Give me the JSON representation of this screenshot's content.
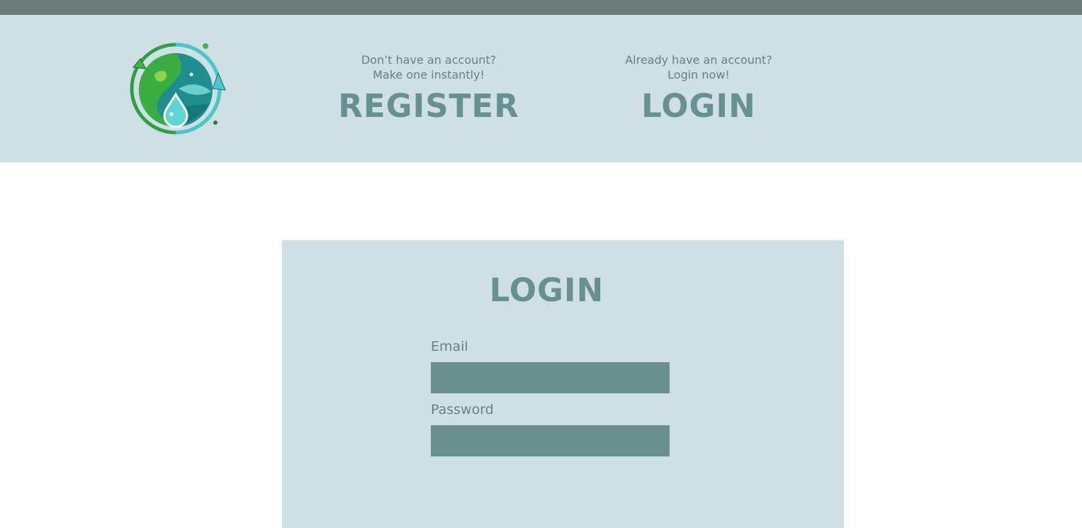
{
  "header": {
    "register": {
      "line1": "Don’t have an account?",
      "line2": "Make one instantly!",
      "label": "REGISTER"
    },
    "login": {
      "line1": "Already have an account?",
      "line2": "Login now!",
      "label": "LOGIN"
    },
    "logo_icon": "earth-water-recycle-logo"
  },
  "form": {
    "title": "LOGIN",
    "email_label": "Email",
    "email_value": "",
    "password_label": "Password",
    "password_value": ""
  },
  "colors": {
    "top_strip": "#6d7a7a",
    "panel_bg": "#cfe0e5",
    "accent": "#669190",
    "input_bg": "#69908f",
    "muted_text": "#6b7d7c"
  }
}
